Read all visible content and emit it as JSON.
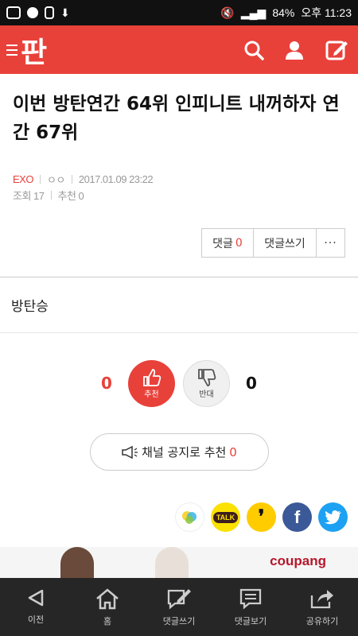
{
  "status_bar": {
    "battery": "84%",
    "time": "오후 11:23"
  },
  "app": {
    "logo": "판",
    "accent": "#e8413a"
  },
  "post": {
    "title": "이번 방탄연간 64위 인피니트 내꺼하자 연간 67위",
    "category": "EXO",
    "author": "ㅇㅇ",
    "datetime": "2017.01.09 23:22",
    "views_label": "조회 17",
    "recommend_label": "추천 0",
    "body": "방탄승"
  },
  "buttons": {
    "comments_label": "댓글",
    "comments_count": "0",
    "write_comment": "댓글쓰기",
    "more": "···"
  },
  "vote": {
    "up_count": "0",
    "up_label": "추천",
    "down_label": "반대",
    "down_count": "0"
  },
  "notice": {
    "label": "채널 공지로 추천",
    "count": "0"
  },
  "share": {
    "icons": [
      "kakaostory-icon",
      "kakaotalk-icon",
      "band-icon",
      "facebook-icon",
      "twitter-icon"
    ],
    "kakao_talk": "TALK",
    "facebook": "f"
  },
  "ad": {
    "brand": "coupang"
  },
  "bottom_nav": [
    {
      "label": "이전",
      "icon": "back-arrow-icon"
    },
    {
      "label": "홈",
      "icon": "home-icon"
    },
    {
      "label": "댓글쓰기",
      "icon": "write-comment-icon"
    },
    {
      "label": "댓글보기",
      "icon": "view-comments-icon"
    },
    {
      "label": "공유하기",
      "icon": "share-icon"
    }
  ]
}
